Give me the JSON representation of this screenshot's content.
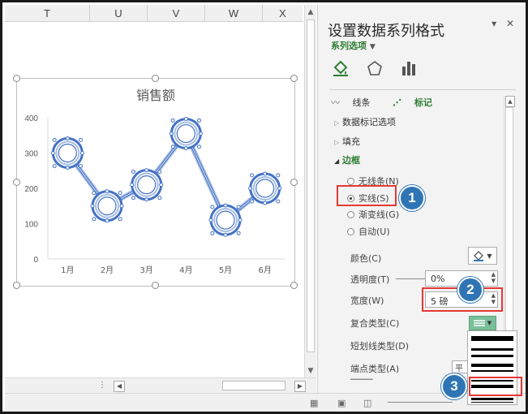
{
  "sheet": {
    "columns": [
      "T",
      "U",
      "V",
      "W",
      "X"
    ]
  },
  "chart_data": {
    "type": "line",
    "title": "销售额",
    "categories": [
      "1月",
      "2月",
      "3月",
      "4月",
      "5月",
      "6月"
    ],
    "values": [
      300,
      150,
      210,
      355,
      110,
      200
    ],
    "ylim": [
      0,
      400
    ],
    "yticks": [
      0,
      100,
      200,
      300,
      400
    ],
    "series_color": "#4472c4",
    "grid": false,
    "legend": false
  },
  "pane": {
    "title": "设置数据系列格式",
    "series_options_label": "系列选项",
    "tabs": [
      {
        "icon": "paint-bucket-icon"
      },
      {
        "icon": "pentagon-icon"
      },
      {
        "icon": "bar-chart-icon"
      }
    ],
    "subtabs": {
      "line": "线条",
      "marker": "标记"
    },
    "sections": {
      "marker_options": "数据标记选项",
      "fill": "填充",
      "border": "边框"
    },
    "radios": {
      "no_line": "无线条(N)",
      "solid": "实线(S)",
      "gradient": "渐变线(G)",
      "auto": "自动(U)"
    },
    "props": {
      "color": "颜色(C)",
      "transparency": "透明度(T)",
      "transparency_value": "0%",
      "width": "宽度(W)",
      "width_value": "5 磅",
      "compound": "复合类型(C)",
      "dash": "短划线类型(D)",
      "cap": "端点类型(A)",
      "cap_value": "平面"
    },
    "badges": [
      "1",
      "2",
      "3"
    ],
    "highlight_color": "#e53935",
    "badge_color": "#2f75b5"
  }
}
